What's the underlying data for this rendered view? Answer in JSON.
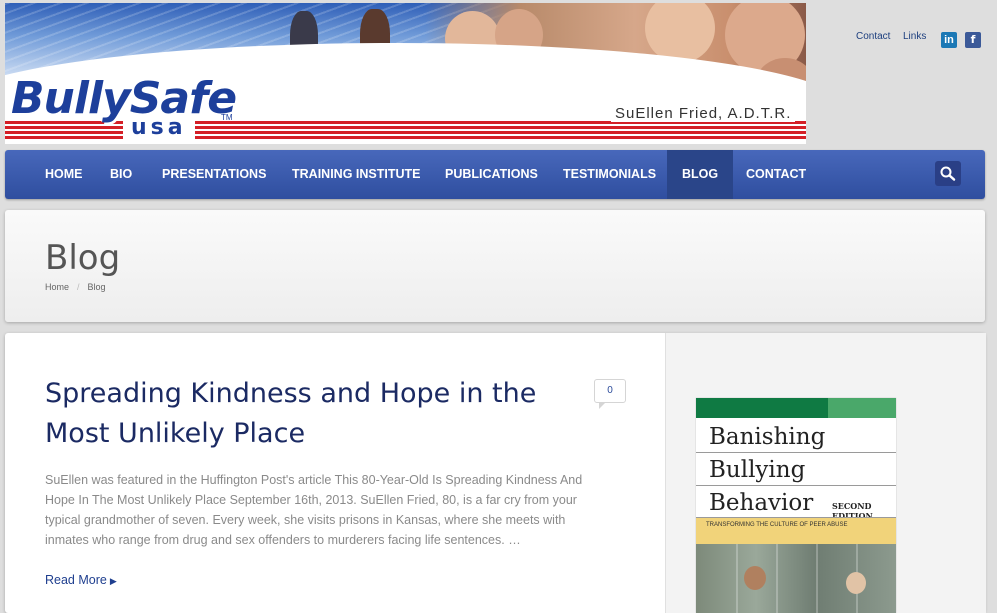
{
  "banner": {
    "logo_main": "BullySafe",
    "logo_sub": "usa",
    "logo_tm": "TM",
    "author": "SuEllen Fried, A.D.T.R."
  },
  "toplinks": {
    "contact": "Contact",
    "links": "Links",
    "linkedin": "in",
    "facebook": "f"
  },
  "nav": {
    "items": [
      "HOME",
      "BIO",
      "PRESENTATIONS",
      "TRAINING INSTITUTE",
      "PUBLICATIONS",
      "TESTIMONIALS",
      "BLOG",
      "CONTACT"
    ],
    "active": "BLOG"
  },
  "header": {
    "title": "Blog",
    "breadcrumb": [
      "Home",
      "Blog"
    ],
    "separator": "/"
  },
  "post": {
    "title": "Spreading Kindness and Hope in the Most Unlikely Place",
    "comments": "0",
    "excerpt": "SuEllen was featured in the Huffington Post's article This 80-Year-Old Is Spreading Kindness And Hope In The Most Unlikely Place September 16th, 2013. SuEllen Fried, 80, is a far cry from your typical grandmother of seven. Every week, she visits prisons in Kansas, where she meets with inmates who range from drug and sex offenders to murderers facing life sentences. …",
    "read_more": "Read More"
  },
  "book": {
    "title_lines": [
      "Banishing",
      "Bullying",
      "Behavior"
    ],
    "edition": "SECOND EDITION",
    "subtitle": "TRANSFORMING THE CULTURE OF PEER ABUSE"
  },
  "colors": {
    "nav": "#3d5cb0",
    "nav_active": "#2a4589",
    "title_text": "#1b2a63",
    "link": "#1f3f8f"
  }
}
